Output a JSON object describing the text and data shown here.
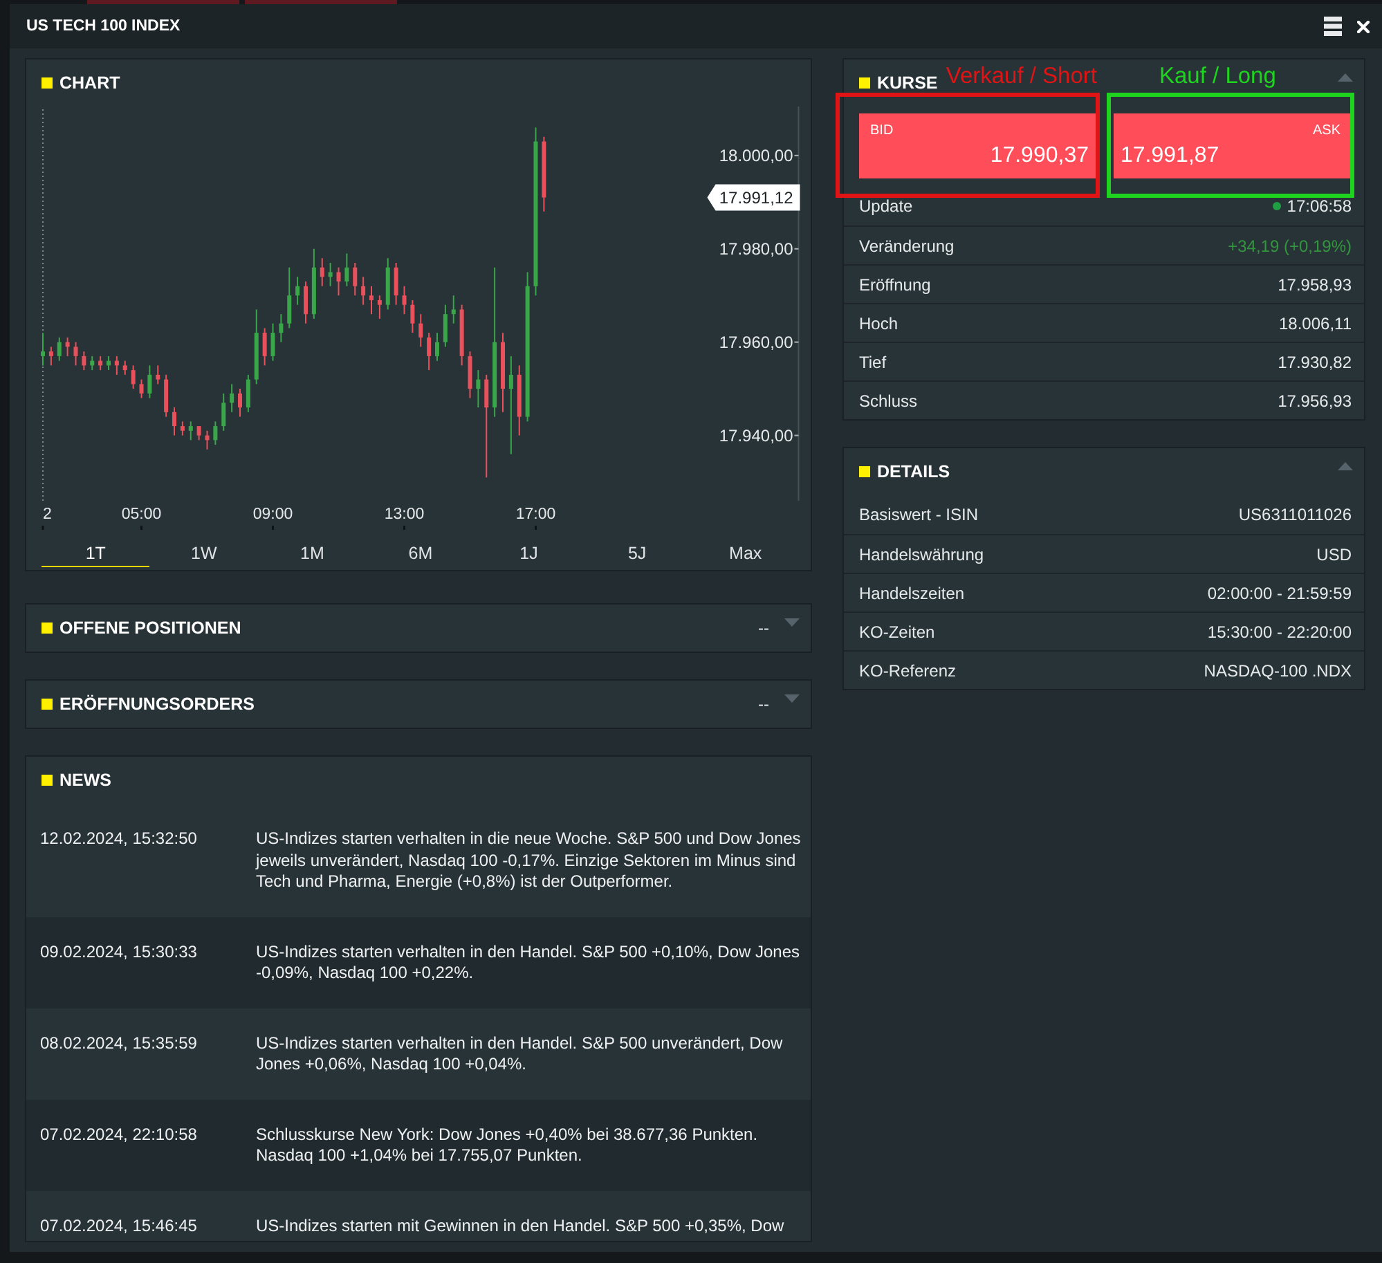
{
  "window": {
    "title": "US TECH 100 INDEX"
  },
  "chart_panel": {
    "title": "CHART",
    "chart_data": {
      "type": "candlestick",
      "x": [
        2,
        2.25,
        2.5,
        2.75,
        3,
        3.25,
        3.5,
        3.75,
        4,
        4.25,
        4.5,
        4.75,
        5,
        5.25,
        5.5,
        5.75,
        6,
        6.25,
        6.5,
        6.75,
        7,
        7.25,
        7.5,
        7.75,
        8,
        8.25,
        8.5,
        8.75,
        9,
        9.25,
        9.5,
        9.75,
        10,
        10.25,
        10.5,
        10.75,
        11,
        11.25,
        11.5,
        11.75,
        12,
        12.25,
        12.5,
        12.75,
        13,
        13.25,
        13.5,
        13.75,
        14,
        14.25,
        14.5,
        14.75,
        15,
        15.25,
        15.5,
        15.75,
        16,
        16.25,
        16.5,
        16.75,
        17,
        17.25
      ],
      "ohlc": [
        [
          17957,
          17962,
          17955,
          17958
        ],
        [
          17958,
          17959,
          17955,
          17957
        ],
        [
          17957,
          17961,
          17956,
          17960
        ],
        [
          17960,
          17961,
          17957,
          17959
        ],
        [
          17959,
          17960,
          17955,
          17957
        ],
        [
          17957,
          17958,
          17954,
          17955
        ],
        [
          17955,
          17957,
          17954,
          17956
        ],
        [
          17956,
          17957,
          17954,
          17955
        ],
        [
          17955,
          17957,
          17954,
          17956
        ],
        [
          17956,
          17957,
          17953,
          17955
        ],
        [
          17955,
          17956,
          17953,
          17954
        ],
        [
          17954,
          17955,
          17950,
          17951
        ],
        [
          17951,
          17952,
          17948,
          17949
        ],
        [
          17949,
          17955,
          17948,
          17953
        ],
        [
          17953,
          17955,
          17951,
          17952
        ],
        [
          17952,
          17953,
          17944,
          17945
        ],
        [
          17945,
          17946,
          17940,
          17942
        ],
        [
          17942,
          17943,
          17940,
          17941
        ],
        [
          17941,
          17943,
          17939,
          17942
        ],
        [
          17942,
          17942,
          17939,
          17940
        ],
        [
          17940,
          17941,
          17937,
          17939
        ],
        [
          17939,
          17943,
          17938,
          17942
        ],
        [
          17942,
          17949,
          17941,
          17947
        ],
        [
          17947,
          17951,
          17945,
          17949
        ],
        [
          17949,
          17950,
          17944,
          17946
        ],
        [
          17946,
          17953,
          17945,
          17952
        ],
        [
          17952,
          17967,
          17951,
          17962
        ],
        [
          17962,
          17963,
          17955,
          17957
        ],
        [
          17957,
          17964,
          17956,
          17962
        ],
        [
          17962,
          17966,
          17960,
          17964
        ],
        [
          17964,
          17976,
          17963,
          17970
        ],
        [
          17970,
          17974,
          17968,
          17972
        ],
        [
          17972,
          17973,
          17964,
          17966
        ],
        [
          17966,
          17980,
          17965,
          17976
        ],
        [
          17976,
          17978,
          17972,
          17974
        ],
        [
          17974,
          17977,
          17972,
          17975
        ],
        [
          17975,
          17976,
          17970,
          17973
        ],
        [
          17973,
          17979,
          17972,
          17976
        ],
        [
          17976,
          17977,
          17970,
          17972
        ],
        [
          17972,
          17974,
          17968,
          17970
        ],
        [
          17970,
          17972,
          17966,
          17969
        ],
        [
          17969,
          17970,
          17965,
          17968
        ],
        [
          17968,
          17978,
          17967,
          17976
        ],
        [
          17976,
          17977,
          17968,
          17970
        ],
        [
          17970,
          17972,
          17966,
          17968
        ],
        [
          17968,
          17969,
          17962,
          17964
        ],
        [
          17964,
          17966,
          17959,
          17961
        ],
        [
          17961,
          17962,
          17954,
          17957
        ],
        [
          17957,
          17962,
          17956,
          17960
        ],
        [
          17960,
          17968,
          17959,
          17966
        ],
        [
          17966,
          17970,
          17964,
          17967
        ],
        [
          17967,
          17968,
          17955,
          17957
        ],
        [
          17957,
          17958,
          17948,
          17950
        ],
        [
          17950,
          17954,
          17946,
          17952
        ],
        [
          17952,
          17953,
          17931,
          17946
        ],
        [
          17946,
          17976,
          17944,
          17960
        ],
        [
          17960,
          17962,
          17945,
          17950
        ],
        [
          17950,
          17957,
          17936,
          17953
        ],
        [
          17953,
          17955,
          17940,
          17944
        ],
        [
          17944,
          17975,
          17943,
          17972
        ],
        [
          17972,
          18006,
          17970,
          18003
        ],
        [
          18003,
          18004,
          17988,
          17991
        ]
      ],
      "xlim": [
        2,
        25
      ],
      "ylim": [
        17926,
        18010.5
      ],
      "xticks": [
        {
          "value": 2,
          "label": "2"
        },
        {
          "value": 5,
          "label": "05:00"
        },
        {
          "value": 9,
          "label": "09:00"
        },
        {
          "value": 13,
          "label": "13:00"
        },
        {
          "value": 17,
          "label": "17:00"
        }
      ],
      "yticks": [
        {
          "value": 17940,
          "label": "17.940,00"
        },
        {
          "value": 17960,
          "label": "17.960,00"
        },
        {
          "value": 17980,
          "label": "17.980,00"
        },
        {
          "value": 18000,
          "label": "18.000,00"
        }
      ]
    },
    "price_tag": "17.991,12",
    "ranges": [
      {
        "label": "1T",
        "selected": true
      },
      {
        "label": "1W",
        "selected": false
      },
      {
        "label": "1M",
        "selected": false
      },
      {
        "label": "6M",
        "selected": false
      },
      {
        "label": "1J",
        "selected": false
      },
      {
        "label": "5J",
        "selected": false
      },
      {
        "label": "Max",
        "selected": false
      }
    ]
  },
  "positions_panel": {
    "title": "OFFENE POSITIONEN",
    "value": "--",
    "expanded": false
  },
  "orders_panel": {
    "title": "ERÖFFNUNGSORDERS",
    "value": "--",
    "expanded": false
  },
  "news_panel": {
    "title": "NEWS",
    "items": [
      {
        "date": "12.02.2024, 15:32:50",
        "text": "US-Indizes starten verhalten in die neue Woche. S&P 500 und Dow Jones jeweils unverändert, Nasdaq 100 -0,17%. Einzige Sektoren im Minus sind Tech und Pharma, Energie (+0,8%) ist der Outperformer."
      },
      {
        "date": "09.02.2024, 15:30:33",
        "text": "US-Indizes starten verhalten in den Handel. S&P 500 +0,10%, Dow Jones -0,09%, Nasdaq 100 +0,22%."
      },
      {
        "date": "08.02.2024, 15:35:59",
        "text": "US-Indizes starten verhalten in den Handel. S&P 500 unverändert, Dow Jones +0,06%, Nasdaq 100 +0,04%."
      },
      {
        "date": "07.02.2024, 22:10:58",
        "text": "Schlusskurse New York: Dow Jones +0,40% bei 38.677,36 Punkten. Nasdaq 100 +1,04% bei 17.755,07 Punkten."
      },
      {
        "date": "07.02.2024, 15:46:45",
        "text": "US-Indizes starten mit Gewinnen in den Handel. S&P 500 +0,35%, Dow"
      }
    ]
  },
  "quotes_panel": {
    "title": "KURSE",
    "expanded": true,
    "annotations": [
      {
        "label": "Verkauf / Short",
        "color": "#e01414"
      },
      {
        "label": "Kauf / Long",
        "color": "#1fd41f"
      }
    ],
    "prices": [
      {
        "kind": "bid",
        "label": "BID",
        "value": "17.990,37"
      },
      {
        "kind": "ask",
        "label": "ASK",
        "value": "17.991,87"
      }
    ],
    "rows": [
      {
        "kind": "status",
        "label": "Update",
        "value": "17:06:58"
      },
      {
        "kind": "change",
        "label": "Veränderung",
        "value": "+34,19 (+0,19%)"
      },
      {
        "kind": "plain",
        "label": "Eröffnung",
        "value": "17.958,93"
      },
      {
        "kind": "plain",
        "label": "Hoch",
        "value": "18.006,11"
      },
      {
        "kind": "plain",
        "label": "Tief",
        "value": "17.930,82"
      },
      {
        "kind": "plain",
        "label": "Schluss",
        "value": "17.956,93"
      }
    ]
  },
  "details_panel": {
    "title": "DETAILS",
    "expanded": true,
    "rows": [
      {
        "label": "Basiswert - ISIN",
        "value": "US6311011026"
      },
      {
        "label": "Handelswährung",
        "value": "USD"
      },
      {
        "label": "Handelszeiten",
        "value": "02:00:00 - 21:59:59"
      },
      {
        "label": "KO-Zeiten",
        "value": "15:30:00 - 22:20:00"
      },
      {
        "label": "KO-Referenz",
        "value": "NASDAQ-100 .NDX"
      }
    ]
  }
}
